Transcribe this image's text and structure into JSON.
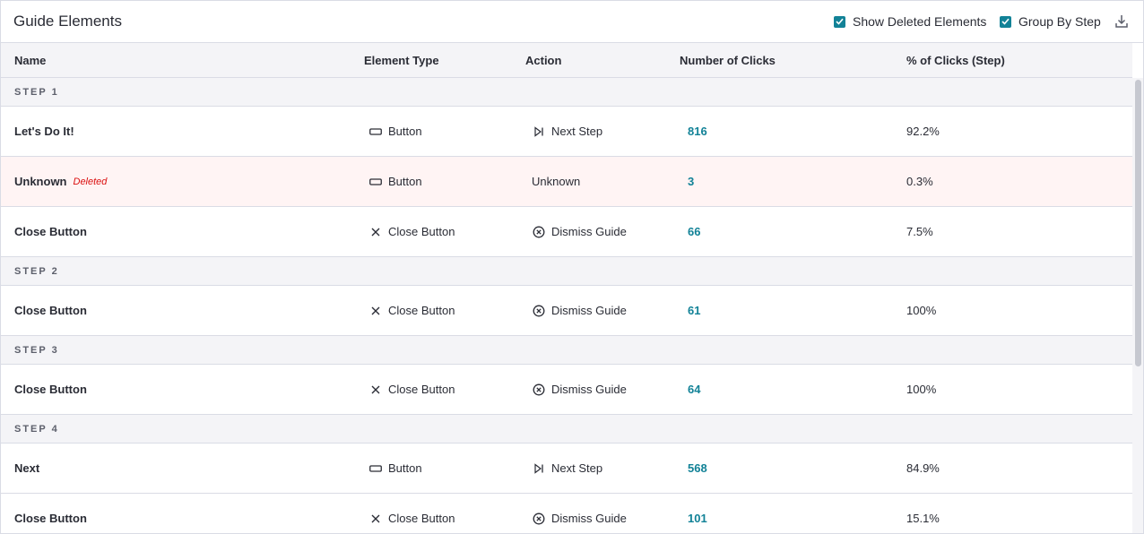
{
  "header": {
    "title": "Guide Elements",
    "show_deleted_label": "Show Deleted Elements",
    "group_by_step_label": "Group By Step",
    "show_deleted_checked": true,
    "group_by_step_checked": true,
    "download_icon": "download-icon"
  },
  "columns": [
    "Name",
    "Element Type",
    "Action",
    "Number of Clicks",
    "% of Clicks (Step)"
  ],
  "steps": [
    {
      "label": "STEP 1"
    },
    {
      "label": "STEP 2"
    },
    {
      "label": "STEP 3"
    },
    {
      "label": "STEP 4"
    }
  ],
  "rows": [
    {
      "name": "Let's Do It!",
      "deleted_tag": "",
      "type": "Button",
      "type_icon": "button-icon",
      "action": "Next Step",
      "action_icon": "next-step-icon",
      "clicks": "816",
      "pct": "92.2%"
    },
    {
      "name": "Unknown",
      "deleted_tag": "Deleted",
      "type": "Button",
      "type_icon": "button-icon",
      "action": "Unknown",
      "action_icon": "",
      "clicks": "3",
      "pct": "0.3%"
    },
    {
      "name": "Close Button",
      "deleted_tag": "",
      "type": "Close Button",
      "type_icon": "close-icon",
      "action": "Dismiss Guide",
      "action_icon": "dismiss-circle-icon",
      "clicks": "66",
      "pct": "7.5%"
    },
    {
      "name": "Close Button",
      "deleted_tag": "",
      "type": "Close Button",
      "type_icon": "close-icon",
      "action": "Dismiss Guide",
      "action_icon": "dismiss-circle-icon",
      "clicks": "61",
      "pct": "100%"
    },
    {
      "name": "Close Button",
      "deleted_tag": "",
      "type": "Close Button",
      "type_icon": "close-icon",
      "action": "Dismiss Guide",
      "action_icon": "dismiss-circle-icon",
      "clicks": "64",
      "pct": "100%"
    },
    {
      "name": "Next",
      "deleted_tag": "",
      "type": "Button",
      "type_icon": "button-icon",
      "action": "Next Step",
      "action_icon": "next-step-icon",
      "clicks": "568",
      "pct": "84.9%"
    },
    {
      "name": "Close Button",
      "deleted_tag": "",
      "type": "Close Button",
      "type_icon": "close-icon",
      "action": "Dismiss Guide",
      "action_icon": "dismiss-circle-icon",
      "clicks": "101",
      "pct": "15.1%"
    }
  ],
  "colors": {
    "accent": "#128297",
    "deleted_text": "#db1111",
    "deleted_row_bg": "#fff4f4",
    "header_bg": "#f4f4f7",
    "border": "#dadce5"
  }
}
